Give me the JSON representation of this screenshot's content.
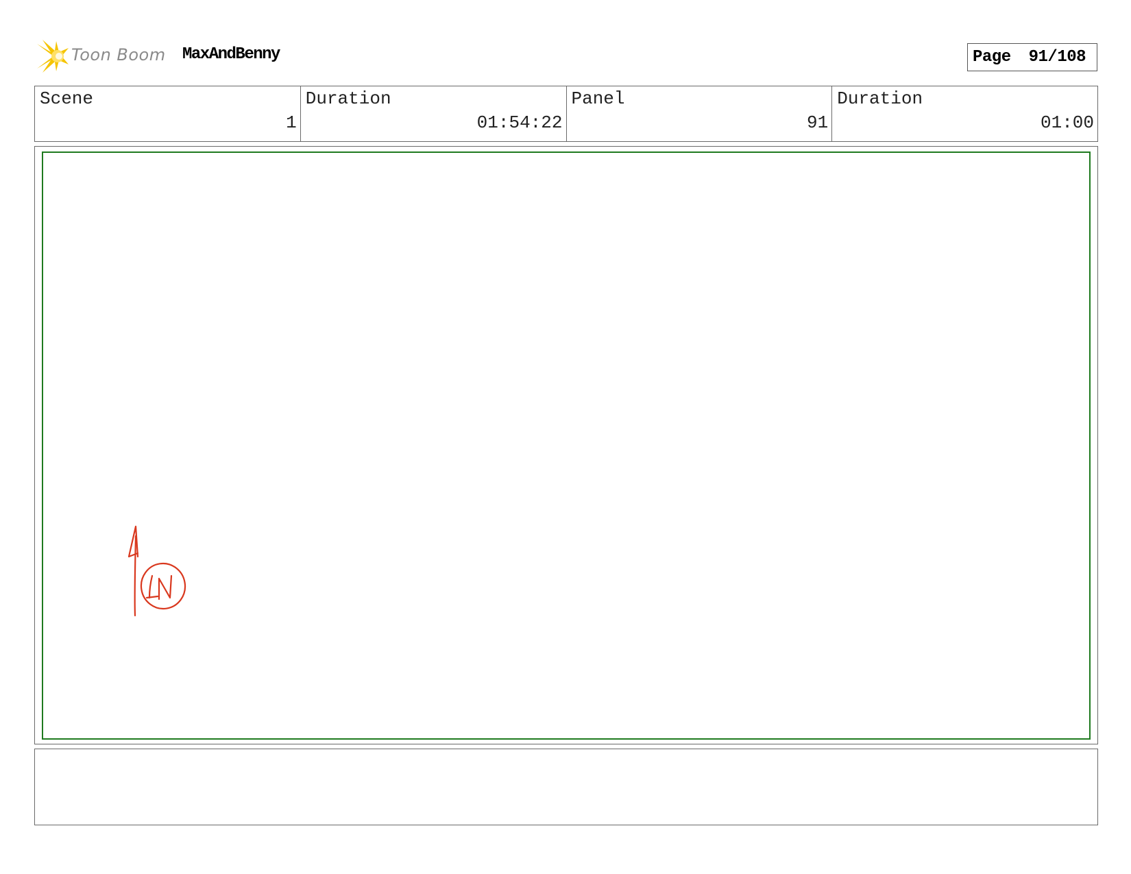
{
  "header": {
    "logo_text": "Toon Boom",
    "project_title": "MaxAndBenny",
    "page_label": "Page",
    "page_number": "91/108"
  },
  "info": {
    "scene_label": "Scene",
    "scene_value": "1",
    "scene_duration_label": "Duration",
    "scene_duration_value": "01:54:22",
    "panel_label": "Panel",
    "panel_value": "91",
    "panel_duration_label": "Duration",
    "panel_duration_value": "01:00"
  },
  "sketch": {
    "annotation_text": "IN",
    "icon": "arrow-up-icon",
    "color": "#d9381e"
  },
  "colors": {
    "panel_border": "#1f7a1f",
    "logo_star": "#f5c400"
  },
  "notes": {
    "text": ""
  }
}
